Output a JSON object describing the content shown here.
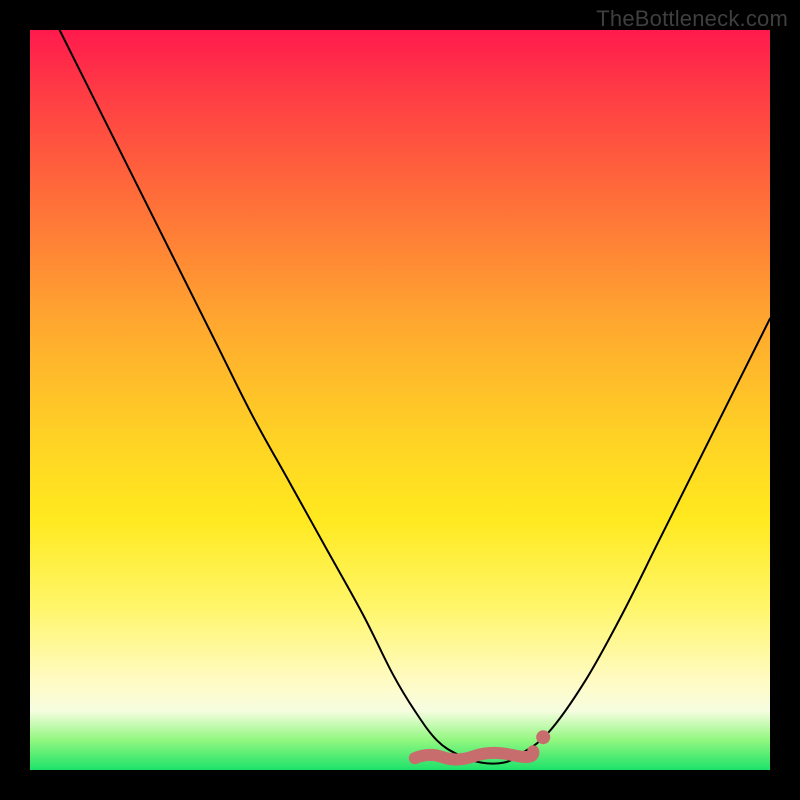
{
  "watermark": "TheBottleneck.com",
  "chart_data": {
    "type": "line",
    "title": "",
    "xlabel": "",
    "ylabel": "",
    "xlim": [
      0,
      100
    ],
    "ylim": [
      0,
      100
    ],
    "series": [
      {
        "name": "bottleneck-curve",
        "x": [
          4,
          10,
          15,
          20,
          25,
          30,
          35,
          40,
          45,
          49,
          52,
          55,
          58,
          61,
          64,
          66,
          70,
          75,
          80,
          85,
          90,
          95,
          100
        ],
        "values": [
          100,
          88,
          78,
          68,
          58,
          48,
          39,
          30,
          21,
          13,
          8,
          4,
          2,
          1,
          1,
          2,
          5,
          12,
          21,
          31,
          41,
          51,
          61
        ]
      }
    ],
    "flat_region": {
      "x_start": 52,
      "x_end": 68,
      "y": 2,
      "marker_color": "#c86d6d"
    },
    "gradient_stops": [
      {
        "pos": 0,
        "color": "#ff1a4d"
      },
      {
        "pos": 22,
        "color": "#ff6b3a"
      },
      {
        "pos": 55,
        "color": "#ffd225"
      },
      {
        "pos": 88,
        "color": "#fffbc4"
      },
      {
        "pos": 100,
        "color": "#1de26a"
      }
    ]
  }
}
